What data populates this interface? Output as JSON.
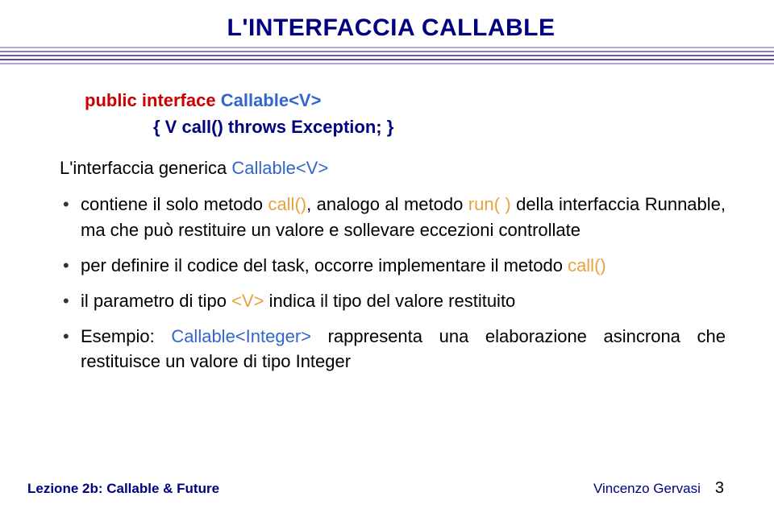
{
  "title": "L'INTERFACCIA CALLABLE",
  "rule_colors": [
    "#b8a8d8",
    "#8c78bc",
    "#6a56a8",
    "#5a4698",
    "#b0a0d0"
  ],
  "code": {
    "l1_a": "public interface ",
    "l1_b": "Callable<V>",
    "l2": "{ V call() throws Exception; }"
  },
  "intro": {
    "a": "L'interfaccia generica ",
    "b": "Callable<V>"
  },
  "bullets": [
    {
      "segments": [
        {
          "t": "contiene il solo metodo ",
          "cls": "c-black"
        },
        {
          "t": "call()",
          "cls": "c-orange"
        },
        {
          "t": ", analogo al metodo ",
          "cls": "c-black"
        },
        {
          "t": "run( )",
          "cls": "c-orange"
        },
        {
          "t": " della interfaccia Runnable, ma che può restituire un valore e sollevare eccezioni controllate",
          "cls": "c-black"
        }
      ]
    },
    {
      "segments": [
        {
          "t": "per definire il codice del task, occorre implementare il metodo ",
          "cls": "c-black"
        },
        {
          "t": "call()",
          "cls": "c-orange"
        }
      ]
    },
    {
      "segments": [
        {
          "t": "il parametro di tipo ",
          "cls": "c-black"
        },
        {
          "t": "<V>",
          "cls": "c-orange"
        },
        {
          "t": " indica il tipo del valore restituito",
          "cls": "c-black"
        }
      ]
    },
    {
      "segments": [
        {
          "t": "Esempio: ",
          "cls": "c-black"
        },
        {
          "t": "Callable<Integer>",
          "cls": "c-blue"
        },
        {
          "t": " rappresenta una elaborazione asincrona che restituisce un valore di tipo Integer",
          "cls": "c-black"
        }
      ]
    }
  ],
  "footer": {
    "left": "Lezione 2b: Callable & Future",
    "author": "Vincenzo Gervasi",
    "page": "3"
  }
}
